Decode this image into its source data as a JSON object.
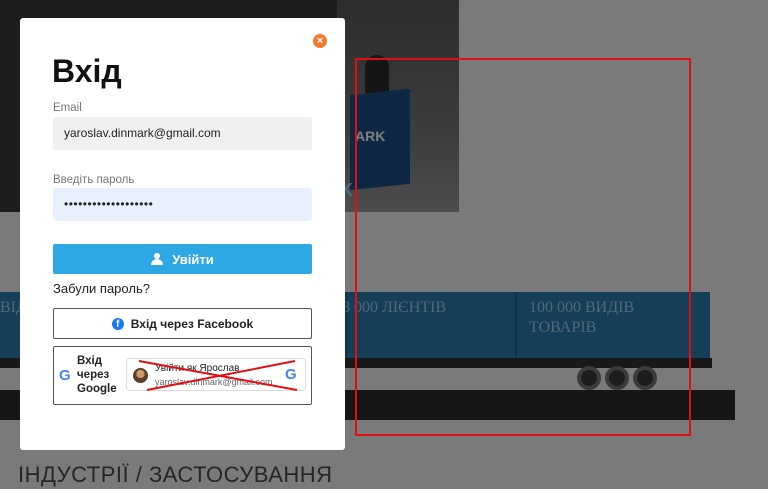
{
  "background": {
    "hero_banner_text": "ARK",
    "hero_banner_text2": "K",
    "container_1": "ВІДІ",
    "container_2": "8 000 ЛІЄНТІВ",
    "container_3": "100 000 ВИДІВ ТОВАРІВ",
    "section_title": "ІНДУСТРІЇ / ЗАСТОСУВАННЯ"
  },
  "modal": {
    "close_glyph": "×",
    "title": "Вхід",
    "email_label": "Email",
    "email_value": "yaroslav.dinmark@gmail.com",
    "password_label": "Введіть пароль",
    "password_value": "•••••••••••••••••••",
    "login_button": "Увійти",
    "forgot_link": "Забули пароль?",
    "facebook_button": "Вхід через Facebook",
    "google_label_1": "Вхід",
    "google_label_2": "через",
    "google_label_3": "Google",
    "google_account_name": "Увійти як Ярослав",
    "google_account_email": "yaroslav.dinmark@gmail.com"
  },
  "colors": {
    "accent": "#2ea8e5",
    "close": "#f47a2c",
    "facebook": "#1877f2",
    "annotation": "#e01010"
  },
  "icons": [
    "close-icon",
    "user-icon",
    "facebook-icon",
    "google-icon",
    "avatar"
  ]
}
